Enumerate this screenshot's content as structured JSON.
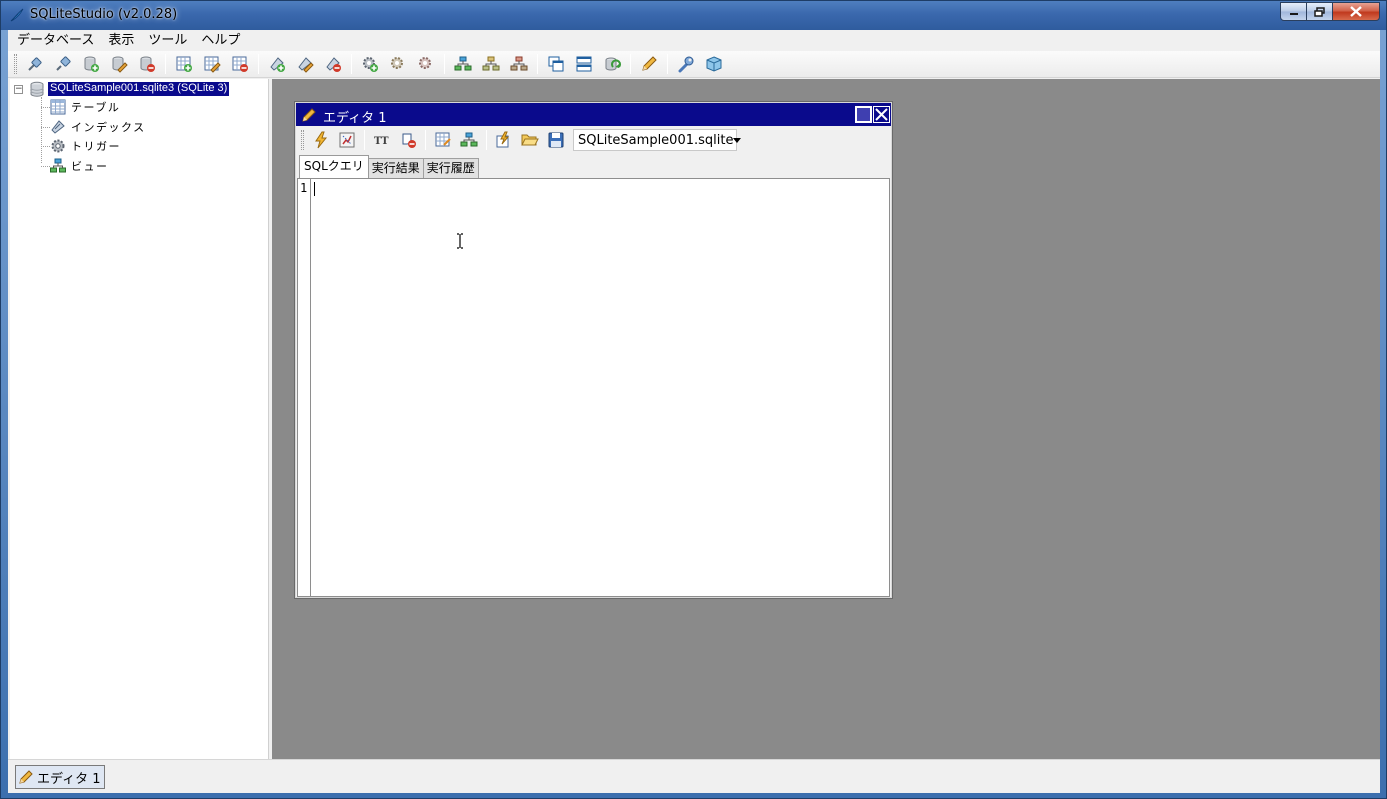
{
  "window": {
    "title": "SQLiteStudio (v2.0.28)"
  },
  "menu": [
    "データベース",
    "表示",
    "ツール",
    "ヘルプ"
  ],
  "toolbar_icons": [
    "connect-db-icon",
    "disconnect-db-icon",
    "add-db-icon",
    "edit-db-icon",
    "remove-db-icon",
    "new-table-icon",
    "edit-table-icon",
    "delete-table-icon",
    "new-index-icon",
    "edit-index-icon",
    "delete-index-icon",
    "new-trigger-icon",
    "edit-trigger-icon",
    "delete-trigger-icon",
    "new-view-icon",
    "edit-view-icon",
    "delete-view-icon",
    "cascade-windows-icon",
    "tile-windows-icon",
    "refresh-icon",
    "open-editor-icon",
    "settings-icon",
    "plugins-icon"
  ],
  "tree": {
    "root": "SQLiteSample001.sqlite3 (SQLite 3)",
    "children": [
      "テーブル",
      "インデックス",
      "トリガー",
      "ビュー"
    ]
  },
  "editor": {
    "title": "エディタ 1",
    "toolbar_icons": [
      "execute-query-icon",
      "explain-query-icon",
      "format-sql-icon",
      "clear-icon",
      "export-results-icon",
      "history-icon",
      "load-sql-icon",
      "open-folder-icon",
      "save-icon"
    ],
    "database": "SQLiteSample001.sqlite",
    "tabs": [
      "SQLクエリ",
      "実行結果",
      "実行履歴"
    ],
    "line_number": "1"
  },
  "taskbar": {
    "button": "エディタ 1"
  },
  "colors": {
    "selection": "#0a0a8c",
    "mdi_background": "#8a8a8a",
    "editor_title": "#0a0a8c"
  }
}
